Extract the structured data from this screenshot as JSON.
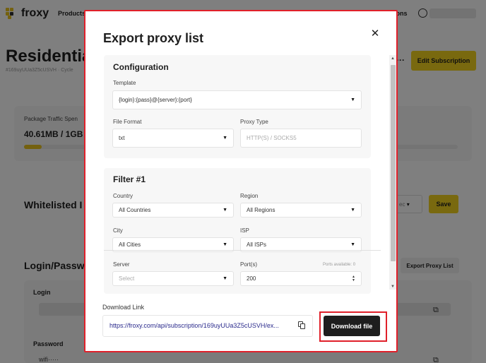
{
  "app": {
    "brand": "froxy",
    "nav_products": "Products",
    "nav_questions": "tions",
    "page_title": "Residentia",
    "subscription_id_line": "#169uyUUa3Z5cUSVH  ·  Cycle",
    "more": "···",
    "edit_subscription": "Edit Subscription",
    "traffic_label": "Package Traffic Spen",
    "traffic_value": "40.61MB / 1GB",
    "traffic_progress": 0.04,
    "whitelist_title": "Whitelisted I",
    "whitelist_select": "ec",
    "whitelist_save": "Save",
    "login_password_title": "Login/Passw",
    "export_proxy_list": "Export Proxy List",
    "login_label": "Login",
    "password_label": "Password",
    "password_value": "wifi·····"
  },
  "modal": {
    "title": "Export proxy list",
    "configuration": {
      "title": "Configuration",
      "template_label": "Template",
      "template_value": "{login}:{pass}@{server}:{port}",
      "file_format_label": "File Format",
      "file_format_value": "txt",
      "proxy_type_label": "Proxy Type",
      "proxy_type_value": "HTTP(S) / SOCKS5"
    },
    "filter": {
      "title": "Filter #1",
      "country_label": "Country",
      "country_value": "All Countries",
      "region_label": "Region",
      "region_value": "All Regions",
      "city_label": "City",
      "city_value": "All Cities",
      "isp_label": "ISP",
      "isp_value": "All ISPs",
      "server_label": "Server",
      "server_placeholder": "Select",
      "ports_label": "Port(s)",
      "ports_available": "Ports available: 0",
      "ports_value": "200"
    },
    "download": {
      "label": "Download Link",
      "link": "https://froxy.com/api/subscription/169uyUUa3Z5cUSVH/ex...",
      "button": "Download file"
    }
  },
  "colors": {
    "accent_yellow": "#f2d21e",
    "highlight_red": "#e0202a",
    "dark_button": "#1e1e1e",
    "link": "#2a2a8c"
  },
  "icons": {
    "close": "close-icon",
    "caret": "chevron-down-icon",
    "copy": "copy-icon",
    "user": "user-icon"
  }
}
